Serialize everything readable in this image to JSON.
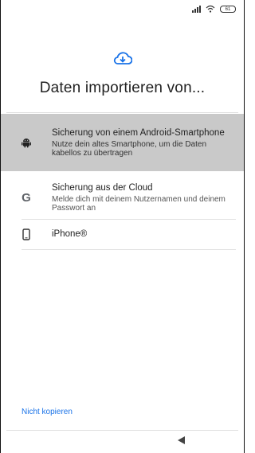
{
  "status_bar": {
    "battery": "61"
  },
  "icons": {
    "hero": "cloud-download-icon",
    "android": "android-icon",
    "cloud": "google-g-icon",
    "iphone": "phone-icon",
    "back": "back-triangle-icon"
  },
  "colors": {
    "accent": "#1a73e8",
    "selected_bg": "#c9c9c9"
  },
  "title": "Daten importieren von...",
  "options": [
    {
      "title": "Sicherung von einem Android-Smartphone",
      "subtitle": "Nutze dein altes Smartphone, um die Daten kabellos zu übertragen"
    },
    {
      "title": "Sicherung aus der Cloud",
      "subtitle": "Melde dich mit deinem Nutzernamen und deinem Passwort an"
    },
    {
      "title": "iPhone®"
    }
  ],
  "footer": {
    "skip_label": "Nicht kopieren"
  }
}
